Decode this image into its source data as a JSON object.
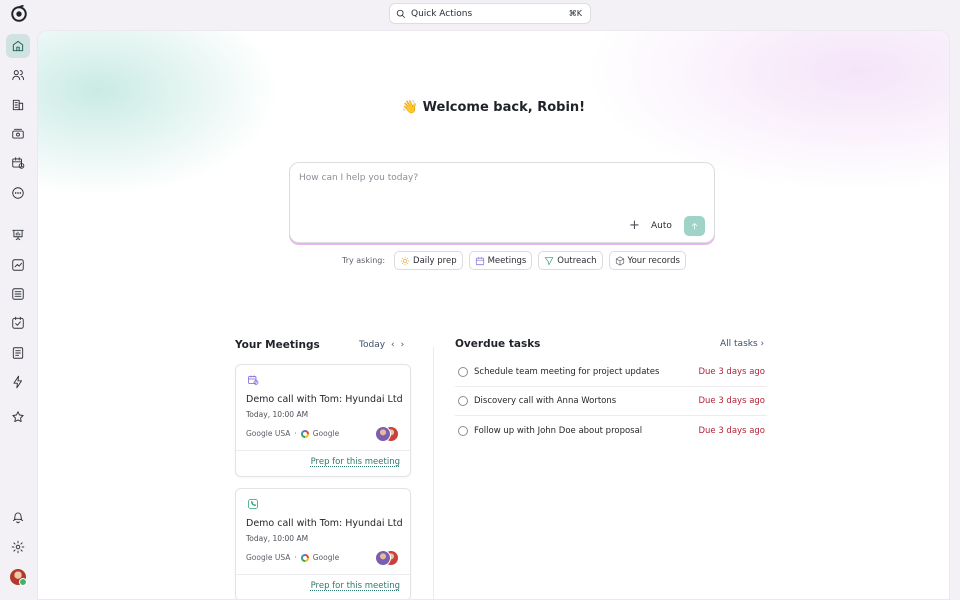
{
  "quick_actions": {
    "label": "Quick Actions",
    "shortcut": "⌘K"
  },
  "sidebar": {
    "items": [
      {
        "name": "home",
        "icon": "home-icon",
        "active": true
      },
      {
        "name": "people",
        "icon": "users-icon"
      },
      {
        "name": "companies",
        "icon": "building-icon"
      },
      {
        "name": "deals",
        "icon": "money-icon"
      },
      {
        "name": "meetings",
        "icon": "calendar-clock-icon"
      },
      {
        "name": "more",
        "icon": "more-icon"
      },
      {
        "name": "reports",
        "icon": "presentation-chart-icon"
      },
      {
        "name": "analytics",
        "icon": "trending-icon"
      },
      {
        "name": "lists",
        "icon": "list-icon"
      },
      {
        "name": "tasks",
        "icon": "checklist-icon"
      },
      {
        "name": "notes",
        "icon": "document-icon"
      },
      {
        "name": "automations",
        "icon": "lightning-icon"
      },
      {
        "name": "favorites",
        "icon": "star-icon"
      }
    ],
    "bottom": [
      {
        "name": "notifications",
        "icon": "bell-icon"
      },
      {
        "name": "settings",
        "icon": "gear-icon"
      }
    ]
  },
  "welcome": {
    "emoji": "👋",
    "text": "Welcome back, Robin!"
  },
  "prompt": {
    "placeholder": "How can I help you today?",
    "mode": "Auto"
  },
  "try_asking": {
    "label": "Try asking:",
    "chips": [
      "Daily prep",
      "Meetings",
      "Outreach",
      "Your records"
    ]
  },
  "meetings": {
    "title": "Your Meetings",
    "filter": "Today",
    "cards": [
      {
        "title": "Demo call with Tom: Hyundai Ltd",
        "time": "Today, 10:00 AM",
        "location": "Google USA",
        "provider": "Google",
        "action": "Prep for this meeting",
        "icon": "calendar-clock-icon"
      },
      {
        "title": "Demo call with Tom: Hyundai Ltd",
        "time": "Today, 10:00 AM",
        "location": "Google USA",
        "provider": "Google",
        "action": "Prep for this meeting",
        "icon": "phone-icon"
      }
    ]
  },
  "tasks": {
    "title": "Overdue tasks",
    "all_link": "All tasks",
    "items": [
      {
        "text": "Schedule team meeting for project updates",
        "due": "Due 3 days ago"
      },
      {
        "text": "Discovery call with Anna Wortons",
        "due": "Due 3 days ago"
      },
      {
        "text": "Follow up with John Doe about proposal",
        "due": "Due 3 days ago"
      }
    ]
  },
  "colors": {
    "accent": "#2f7a6c",
    "overdue": "#b2243a",
    "send": "#9fd3c8"
  }
}
